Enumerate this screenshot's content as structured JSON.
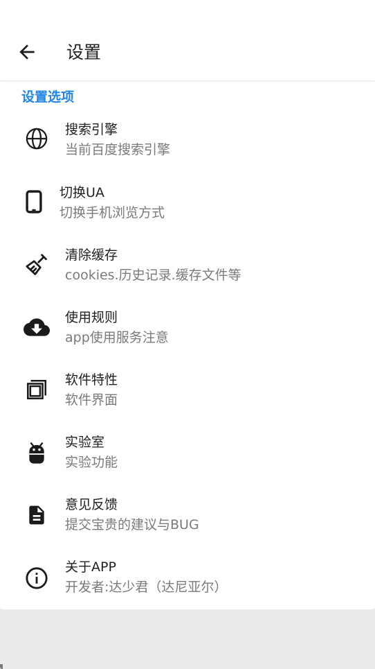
{
  "toolbar": {
    "title": "设置",
    "back_icon": "arrow-back-icon"
  },
  "section": {
    "header": "设置选项"
  },
  "colors": {
    "accent": "#2286e8",
    "title_text": "#1f1f1f",
    "sub_text": "#7a7a7a",
    "background": "#ebebeb",
    "surface": "#ffffff"
  },
  "items": [
    {
      "icon": "globe-icon",
      "title": "搜索引擎",
      "subtitle": "当前百度搜索引擎"
    },
    {
      "icon": "tablet-icon",
      "title": "切换UA",
      "subtitle": "切换手机浏览方式"
    },
    {
      "icon": "broom-icon",
      "title": "清除缓存",
      "subtitle": "cookies.历史记录.缓存文件等"
    },
    {
      "icon": "cloud-download-icon",
      "title": "使用规则",
      "subtitle": "app使用服务注意"
    },
    {
      "icon": "layers-icon",
      "title": "软件特性",
      "subtitle": "软件界面"
    },
    {
      "icon": "android-icon",
      "title": "实验室",
      "subtitle": "实验功能"
    },
    {
      "icon": "document-icon",
      "title": "意见反馈",
      "subtitle": "提交宝贵的建议与BUG"
    },
    {
      "icon": "info-icon",
      "title": "关于APP",
      "subtitle": "开发者:达少君（达尼亚尔）"
    }
  ]
}
